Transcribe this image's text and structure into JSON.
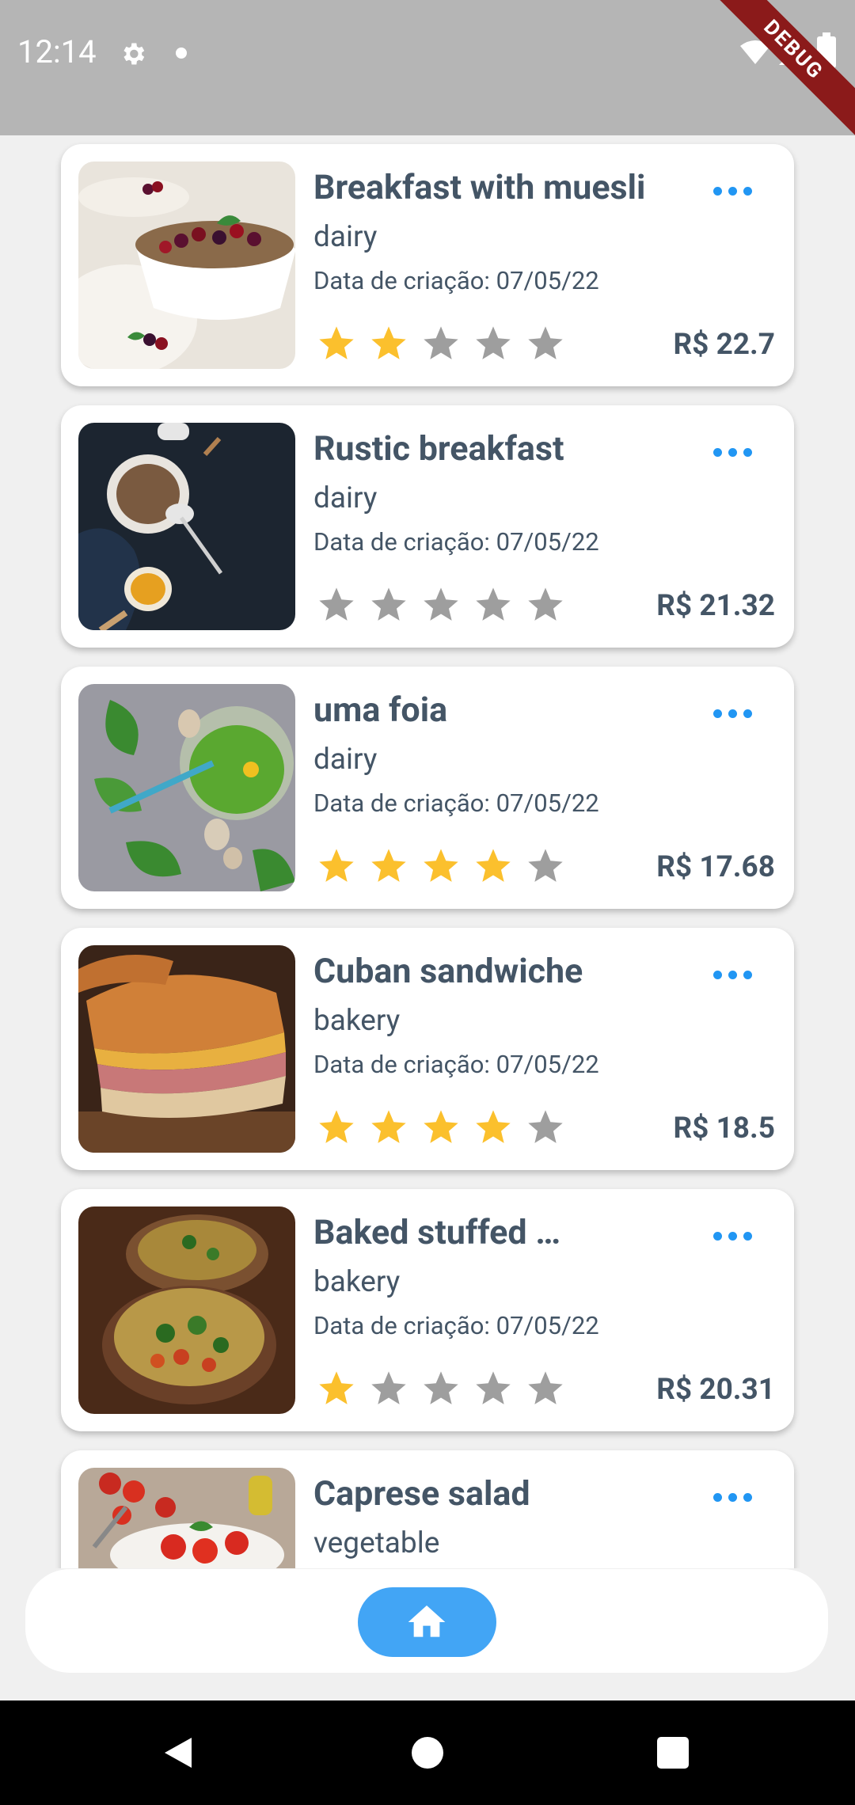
{
  "status_bar": {
    "time": "12:14",
    "debug_label": "DEBUG",
    "icons": [
      "gear-icon",
      "dot-icon",
      "wifi-icon",
      "signal-icon",
      "battery-icon"
    ]
  },
  "colors": {
    "accent": "#2196f3",
    "button": "#42a5f5",
    "star_filled": "#fbc02d",
    "star_empty": "#9e9e9e",
    "text": "#445566",
    "debug_ribbon": "#8b1a1a"
  },
  "recipes": [
    {
      "title": "Breakfast with muesli",
      "category": "dairy",
      "date": "Data de criação: 07/05/22",
      "rating": 2,
      "price": "R$ 22.7",
      "image": "muesli-bowl"
    },
    {
      "title": "Rustic breakfast",
      "category": "dairy",
      "date": "Data de criação: 07/05/22",
      "rating": 0,
      "price": "R$ 21.32",
      "image": "rustic-breakfast"
    },
    {
      "title": "uma foia",
      "category": "dairy",
      "date": "Data de criação: 07/05/22",
      "rating": 4,
      "price": "R$ 17.68",
      "image": "green-smoothie"
    },
    {
      "title": "Cuban sandwiche",
      "category": "bakery",
      "date": "Data de criação: 07/05/22",
      "rating": 4,
      "price": "R$ 18.5",
      "image": "cuban-sandwich"
    },
    {
      "title": "Baked stuffed …",
      "category": "bakery",
      "date": "Data de criação: 07/05/22",
      "rating": 1,
      "price": "R$ 20.31",
      "image": "stuffed-mushroom"
    },
    {
      "title": "Caprese salad",
      "category": "vegetable",
      "date": "",
      "rating": 0,
      "price": "",
      "image": "caprese-salad"
    }
  ],
  "bottom_nav": {
    "home_icon": "home-icon"
  },
  "system_nav": {
    "icons": [
      "back-icon",
      "home-circle-icon",
      "recents-icon"
    ]
  }
}
